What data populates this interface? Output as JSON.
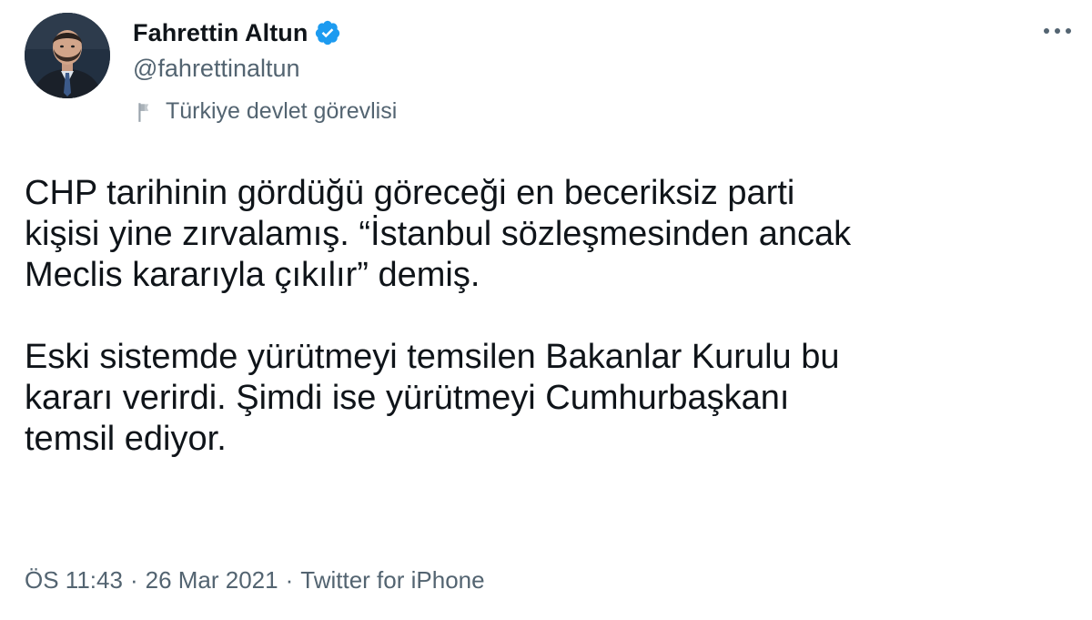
{
  "author": {
    "display_name": "Fahrettin Altun",
    "handle": "@fahrettinaltun",
    "affiliation": "Türkiye devlet görevlisi",
    "verified": true
  },
  "tweet": {
    "paragraph_1": "CHP tarihinin gördüğü göreceği en beceriksiz parti\nkişisi yine zırvalamış. “İstanbul sözleşmesinden ancak\nMeclis kararıyla çıkılır” demiş.",
    "paragraph_2": "Eski sistemde yürütmeyi temsilen Bakanlar Kurulu bu\nkararı verirdi. Şimdi ise yürütmeyi Cumhurbaşkanı\ntemsil ediyor."
  },
  "meta": {
    "time": "ÖS 11:43",
    "separator": "·",
    "date": "26 Mar 2021",
    "source": "Twitter for iPhone"
  },
  "colors": {
    "primary_text": "#0f1419",
    "secondary_text": "#536471",
    "verified_blue": "#1d9bf0"
  },
  "icons": {
    "verified": "verified-badge-icon",
    "affiliation": "flag-icon",
    "more": "more-options-icon"
  }
}
